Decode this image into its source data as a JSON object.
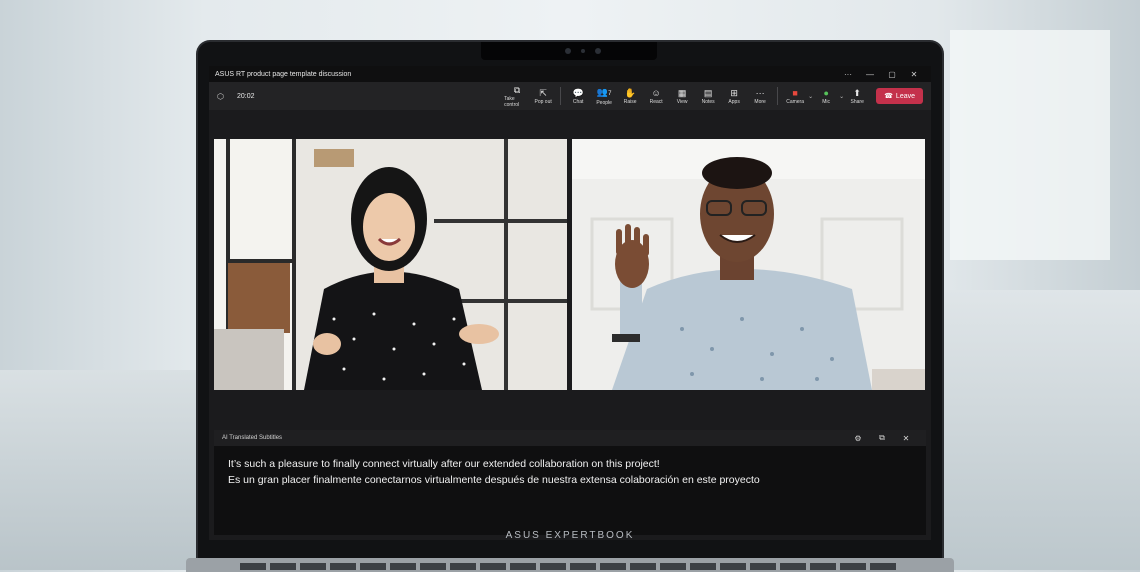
{
  "window": {
    "title": "ASUS RT product page template discussion",
    "controls": {
      "more": "···",
      "minimize": "—",
      "restore": "▢",
      "close": "✕"
    }
  },
  "meeting": {
    "timer": "20:02",
    "toolbar": [
      {
        "id": "take-control",
        "label": "Take control",
        "icon": "⧉"
      },
      {
        "id": "pop-out",
        "label": "Pop out",
        "icon": "⇱"
      },
      {
        "id": "chat",
        "label": "Chat",
        "icon": "💬"
      },
      {
        "id": "people",
        "label": "People",
        "icon": "👥",
        "badge": "7"
      },
      {
        "id": "raise",
        "label": "Raise",
        "icon": "✋"
      },
      {
        "id": "react",
        "label": "React",
        "icon": "☺"
      },
      {
        "id": "view",
        "label": "View",
        "icon": "▦"
      },
      {
        "id": "notes",
        "label": "Notes",
        "icon": "▤"
      },
      {
        "id": "apps",
        "label": "Apps",
        "icon": "⊞"
      },
      {
        "id": "more",
        "label": "More",
        "icon": "···"
      }
    ],
    "camera_label": "Camera",
    "mic_label": "Mic",
    "share_label": "Share",
    "leave_label": "Leave"
  },
  "subtitles": {
    "header": "AI Translated Subtitles",
    "line_en": "It’s such a pleasure to finally connect virtually after our extended collaboration on this project!",
    "line_es": "Es un gran placer finalmente conectarnos virtualmente después de nuestra extensa colaboración en este proyecto"
  },
  "device": {
    "brand": "ASUS EXPERTBOOK"
  },
  "colors": {
    "leave": "#c4314b",
    "camera_icon": "#e8483d",
    "mic_icon": "#56c35a"
  }
}
